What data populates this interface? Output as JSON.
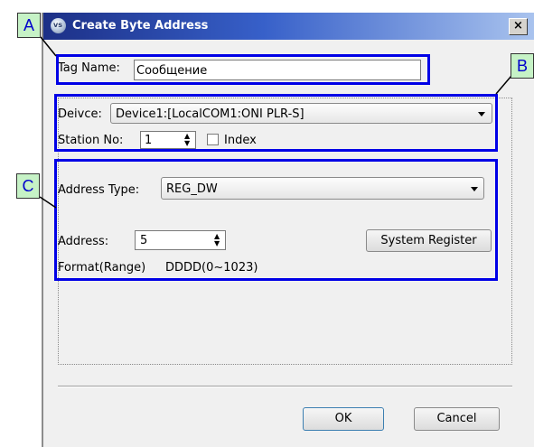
{
  "dialog": {
    "title": "Create Byte Address",
    "close_glyph": "×",
    "icon": "app-icon"
  },
  "callouts": {
    "a": "A",
    "b": "B",
    "c": "C"
  },
  "tag": {
    "label": "Tag Name:",
    "value": "Сообщение"
  },
  "device": {
    "label": "Deivce:",
    "value": "Device1:[LocalCOM1:ONI PLR-S]"
  },
  "station": {
    "label": "Station No:",
    "value": "1"
  },
  "index_check": {
    "label": "Index",
    "checked": false
  },
  "address_type": {
    "label": "Address Type:",
    "value": "REG_DW"
  },
  "address": {
    "label": "Address:",
    "value": "5"
  },
  "system_register_button": "System Register",
  "format": {
    "label": "Format(Range)",
    "value": "DDDD(0~1023)"
  },
  "buttons": {
    "ok": "OK",
    "cancel": "Cancel"
  },
  "colors": {
    "highlight": "#0000e6",
    "callout_bg": "#c6f2c6",
    "title_start": "#1c2f86"
  }
}
